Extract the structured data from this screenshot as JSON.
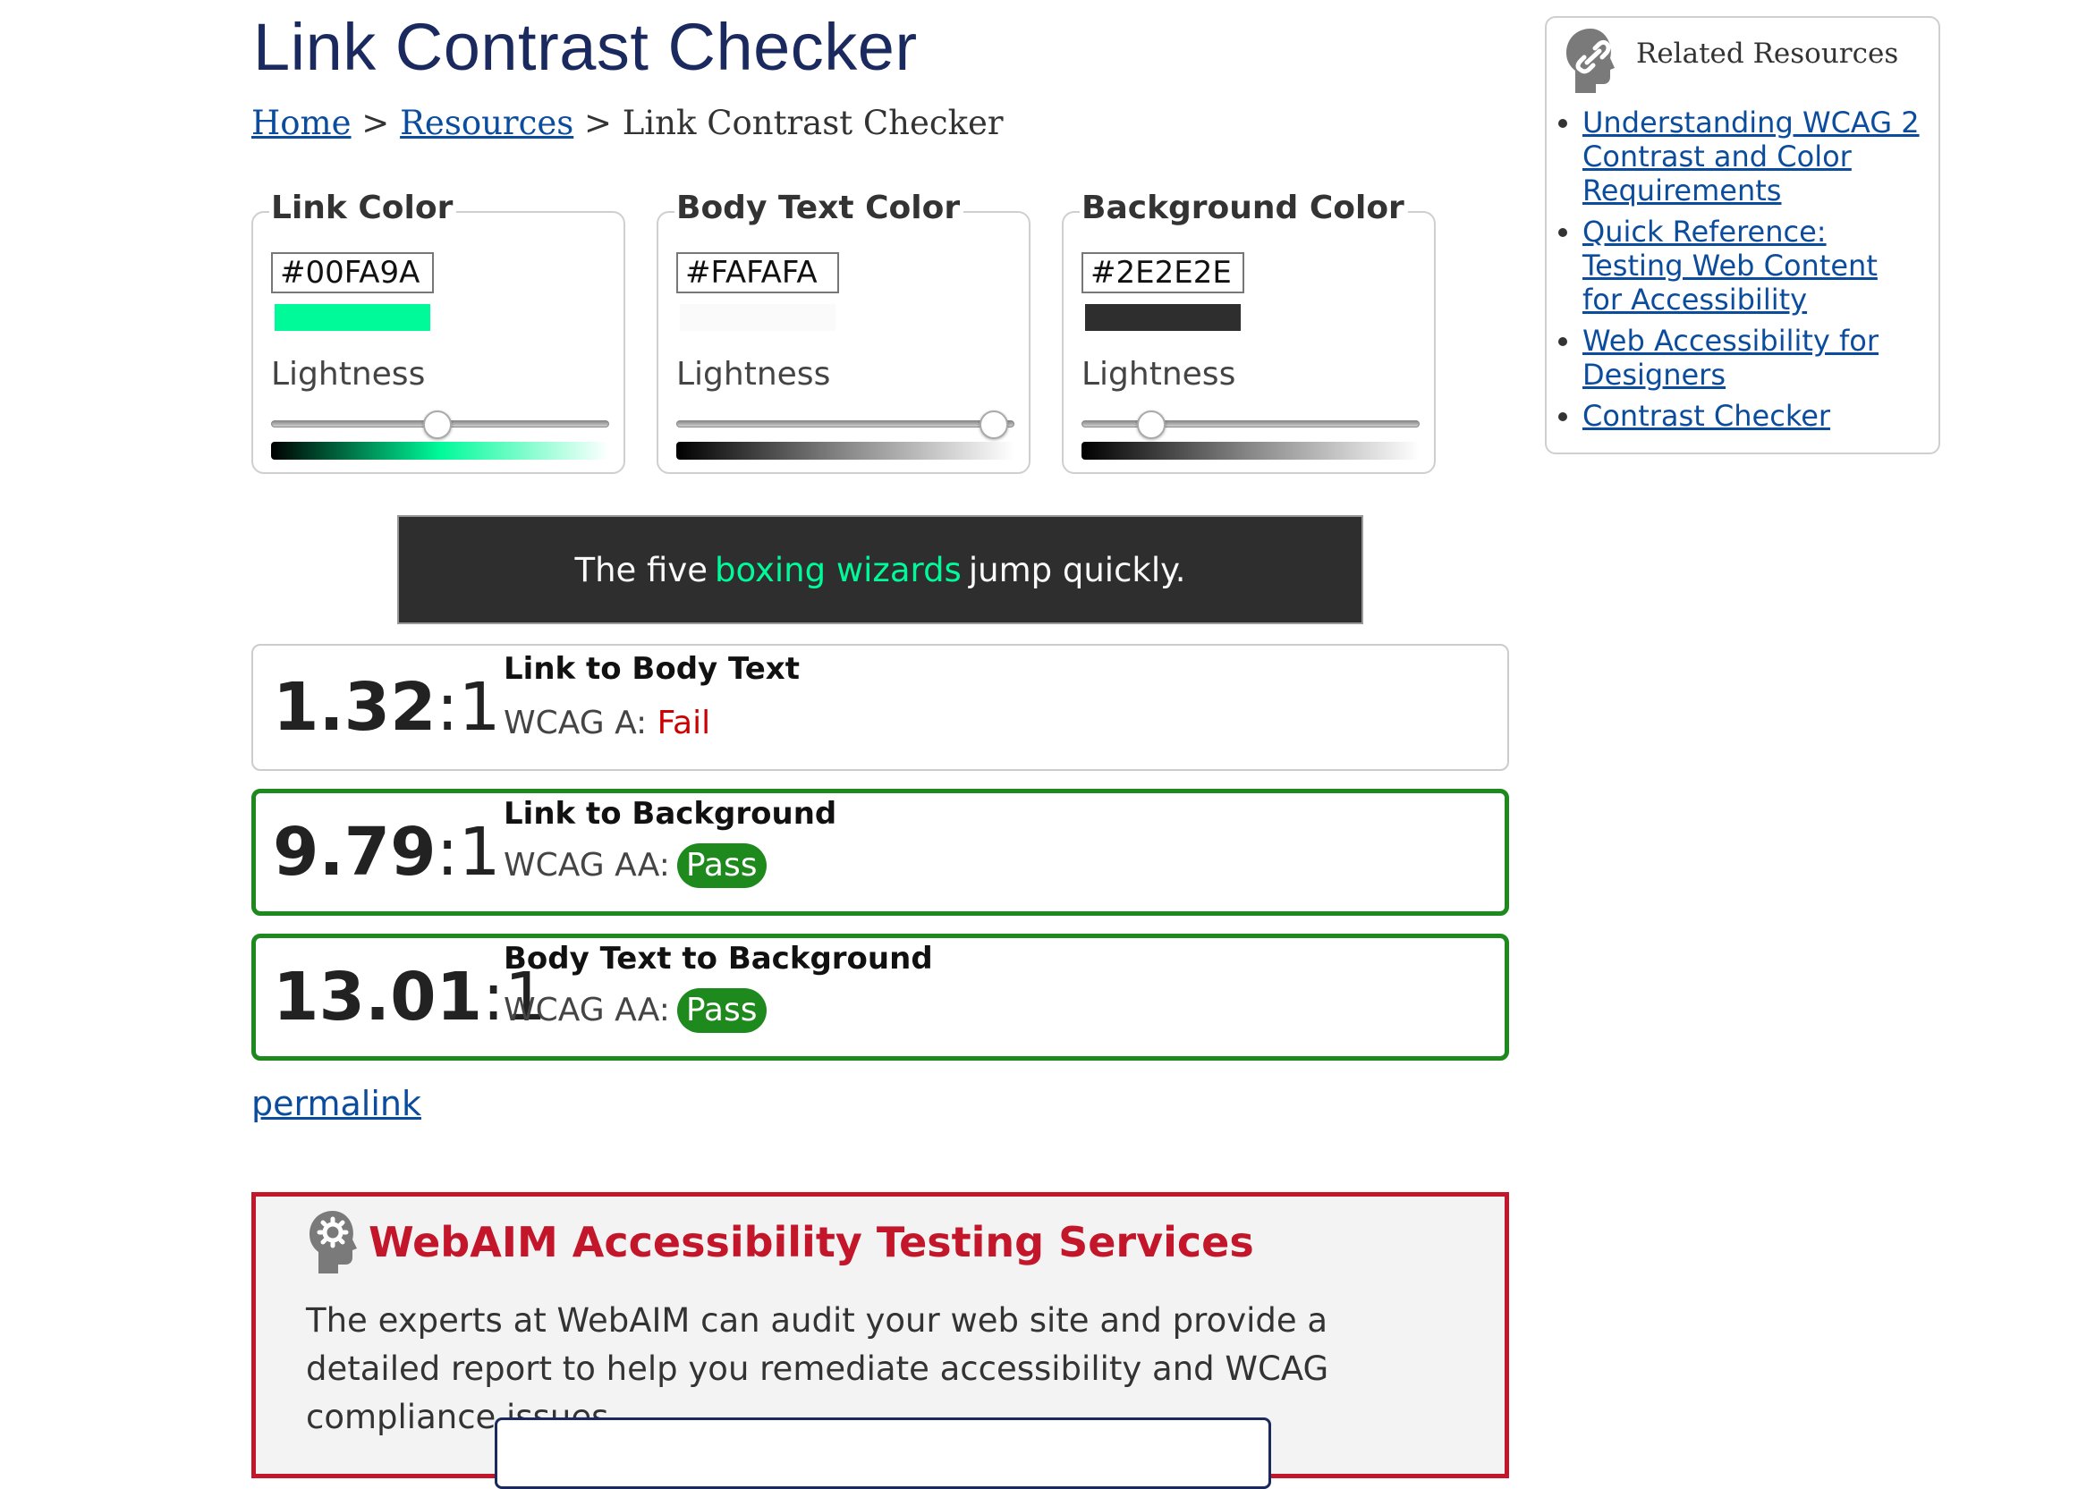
{
  "page": {
    "title": "Link Contrast Checker",
    "breadcrumb": {
      "home": "Home",
      "sep1": ">",
      "resources": "Resources",
      "sep2": ">",
      "current": "Link Contrast Checker"
    }
  },
  "pickers": [
    {
      "legend": "Link Color",
      "hex": "#00FA9A",
      "swatch_color": "#00FA9A",
      "lightness_label": "Lightness",
      "lightness_percent": 49,
      "gradient": [
        "#000000",
        "#00FA9A",
        "#ffffff"
      ]
    },
    {
      "legend": "Body Text Color",
      "hex": "#FAFAFA",
      "swatch_color": "#FAFAFA",
      "lightness_label": "Lightness",
      "lightness_percent": 98,
      "gradient": [
        "#000000",
        "#888888",
        "#ffffff"
      ]
    },
    {
      "legend": "Background Color",
      "hex": "#2E2E2E",
      "swatch_color": "#2E2E2E",
      "lightness_label": "Lightness",
      "lightness_percent": 18,
      "gradient": [
        "#000000",
        "#888888",
        "#ffffff"
      ]
    }
  ],
  "sample": {
    "before": "The five",
    "link": "boxing wizards",
    "after": "jump quickly.",
    "background": "#2E2E2E",
    "text_color": "#FAFAFA",
    "link_color": "#00FA9A"
  },
  "results": [
    {
      "ratio_main": "1.32",
      "ratio_suffix": ":1",
      "title": "Link to Body Text",
      "level": "WCAG A:",
      "status": "Fail"
    },
    {
      "ratio_main": "9.79",
      "ratio_suffix": ":1",
      "title": "Link to Background",
      "level": "WCAG AA:",
      "status": "Pass"
    },
    {
      "ratio_main": "13.01",
      "ratio_suffix": ":1",
      "title": "Body Text to Background",
      "level": "WCAG AA:",
      "status": "Pass"
    }
  ],
  "permalink": "permalink",
  "services": {
    "title": "WebAIM Accessibility Testing Services",
    "text": "The experts at WebAIM can audit your web site and provide a detailed report to help you remediate accessibility and WCAG compliance issues.",
    "icon": "gear-head-icon"
  },
  "related": {
    "title": "Related Resources",
    "icon": "link-head-icon",
    "items": [
      "Understanding WCAG 2 Contrast and Color Requirements",
      "Quick Reference: Testing Web Content for Accessibility",
      "Web Accessibility for Designers",
      "Contrast Checker"
    ]
  },
  "colors": {
    "title": "#1b2a5e",
    "link": "#0b4c9c",
    "pass": "#1e8a1e",
    "fail": "#cc0000",
    "brand_red": "#c3162b"
  }
}
